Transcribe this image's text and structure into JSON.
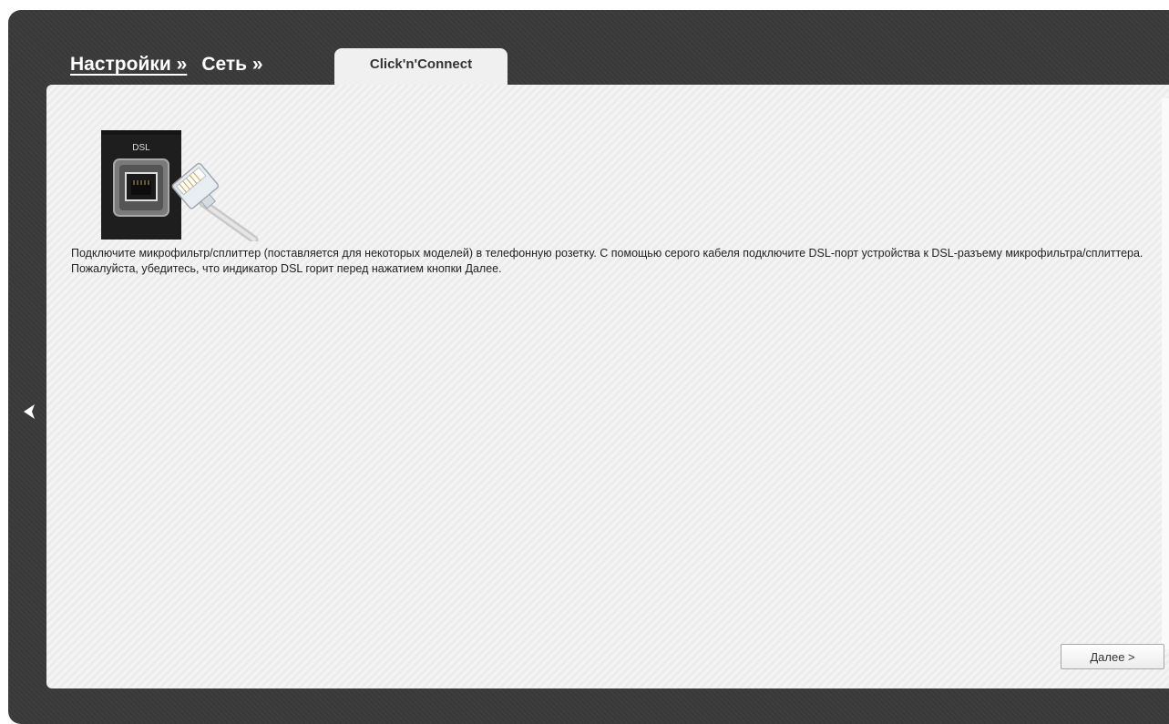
{
  "breadcrumb": {
    "item1": "Настройки »",
    "item2": "Сеть »"
  },
  "tab": {
    "label": "Click'n'Connect"
  },
  "illustration": {
    "port_label": "DSL"
  },
  "instructions": {
    "line1": "Подключите микрофильтр/сплиттер (поставляется для некоторых моделей) в телефонную розетку. С помощью серого кабеля подключите DSL-порт устройства к DSL-разъему микрофильтра/сплиттера.",
    "line2": "Пожалуйста, убедитесь, что индикатор DSL горит перед нажатием кнопки Далее."
  },
  "buttons": {
    "next": "Далее >"
  },
  "icons": {
    "back": "chevron-left-icon"
  },
  "colors": {
    "frame": "#3a3a3a",
    "panel": "#efefef",
    "tab": "#f0f0f0"
  }
}
